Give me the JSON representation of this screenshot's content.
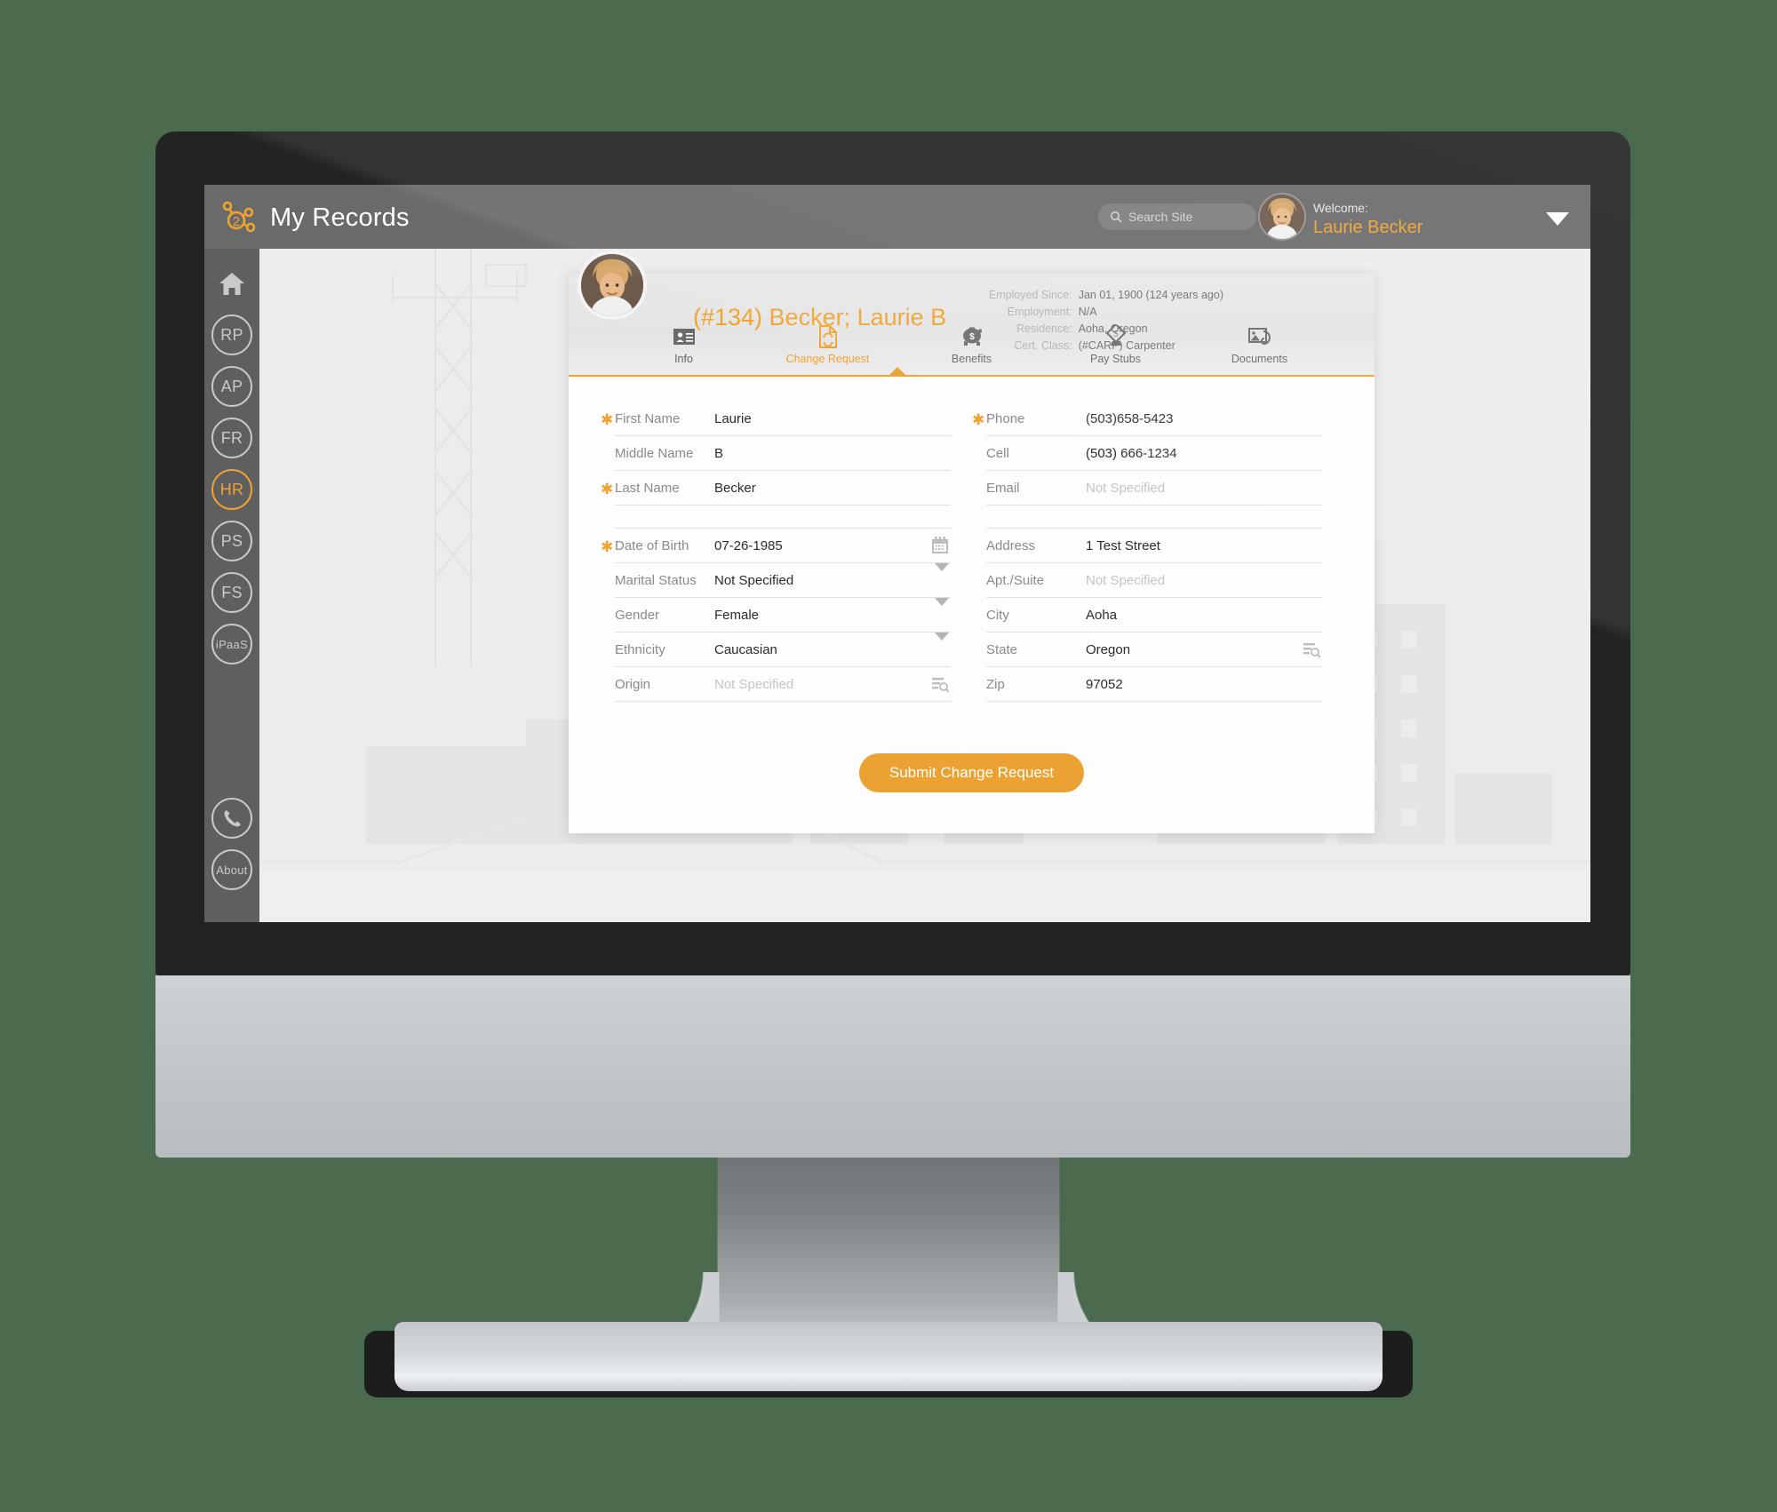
{
  "theme": {
    "accent": "#f0a32e",
    "topbar_bg": "#6a6a6a",
    "rail_bg": "#5f5f5f",
    "page_bg": "#4b6b4e",
    "card_bg": "#fdfdfd"
  },
  "topbar": {
    "app_title": "My Records",
    "logo_icon": "two-node-network-logo",
    "search": {
      "placeholder": "Search Site",
      "icon": "search-icon"
    },
    "welcome_label": "Welcome:",
    "welcome_name": "Laurie Becker",
    "caret_icon": "chevron-down-icon",
    "avatar_icon": "user-avatar"
  },
  "sidebar": {
    "items": [
      {
        "id": "home",
        "label": "",
        "icon": "home-icon",
        "style": "plain",
        "active": false
      },
      {
        "id": "rp",
        "label": "RP",
        "icon": "rp-icon",
        "style": "circle",
        "active": false
      },
      {
        "id": "ap",
        "label": "AP",
        "icon": "ap-icon",
        "style": "circle",
        "active": false
      },
      {
        "id": "fr",
        "label": "FR",
        "icon": "fr-icon",
        "style": "circle",
        "active": false
      },
      {
        "id": "hr",
        "label": "HR",
        "icon": "hr-icon",
        "style": "circle",
        "active": true
      },
      {
        "id": "ps",
        "label": "PS",
        "icon": "ps-icon",
        "style": "circle",
        "active": false
      },
      {
        "id": "fs",
        "label": "FS",
        "icon": "fs-icon",
        "style": "circle",
        "active": false
      },
      {
        "id": "ipaas",
        "label": "iPaaS",
        "icon": "ipaas-icon",
        "style": "circle-small",
        "active": false
      }
    ],
    "bottom_items": [
      {
        "id": "phone",
        "label": "",
        "icon": "phone-icon"
      },
      {
        "id": "about",
        "label": "About",
        "icon": "about-icon"
      }
    ]
  },
  "record": {
    "title": "(#134) Becker; Laurie B",
    "avatar_icon": "employee-avatar",
    "meta": [
      {
        "key": "Employed Since:",
        "value": "Jan 01, 1900 (124 years ago)"
      },
      {
        "key": "Employment:",
        "value": "N/A"
      },
      {
        "key": "Residence:",
        "value": "Aoha, Oregon"
      },
      {
        "key": "Cert. Class:",
        "value": "(#CARP) Carpenter"
      }
    ],
    "tabs": [
      {
        "id": "info",
        "label": "Info",
        "icon": "id-card-icon",
        "active": false
      },
      {
        "id": "change-request",
        "label": "Change Request",
        "icon": "document-sync-icon",
        "active": true
      },
      {
        "id": "benefits",
        "label": "Benefits",
        "icon": "piggy-bank-icon",
        "active": false
      },
      {
        "id": "pay-stubs",
        "label": "Pay Stubs",
        "icon": "money-stamp-icon",
        "active": false
      },
      {
        "id": "documents",
        "label": "Documents",
        "icon": "document-attach-icon",
        "active": false
      }
    ]
  },
  "form": {
    "left_fields": [
      {
        "id": "first-name",
        "label": "First Name",
        "value": "Laurie",
        "placeholder": "",
        "required": true,
        "adornment": "none"
      },
      {
        "id": "middle-name",
        "label": "Middle Name",
        "value": "B",
        "placeholder": "",
        "required": false,
        "adornment": "none"
      },
      {
        "id": "last-name",
        "label": "Last Name",
        "value": "Becker",
        "placeholder": "",
        "required": true,
        "adornment": "none"
      },
      {
        "id": "spacer-left",
        "label": "",
        "value": "",
        "placeholder": "",
        "required": false,
        "adornment": "spacer"
      },
      {
        "id": "date-of-birth",
        "label": "Date of Birth",
        "value": "07-26-1985",
        "placeholder": "",
        "required": true,
        "adornment": "calendar-icon"
      },
      {
        "id": "marital-status",
        "label": "Marital Status",
        "value": "Not Specified",
        "placeholder": "",
        "required": false,
        "adornment": "chevron-down-icon"
      },
      {
        "id": "gender",
        "label": "Gender",
        "value": "Female",
        "placeholder": "",
        "required": false,
        "adornment": "chevron-down-icon"
      },
      {
        "id": "ethnicity",
        "label": "Ethnicity",
        "value": "Caucasian",
        "placeholder": "",
        "required": false,
        "adornment": "chevron-down-icon"
      },
      {
        "id": "origin",
        "label": "Origin",
        "value": "",
        "placeholder": "Not Specified",
        "required": false,
        "adornment": "lookup-icon"
      }
    ],
    "right_fields": [
      {
        "id": "phone",
        "label": "Phone",
        "value": "(503)658-5423",
        "placeholder": "",
        "required": true,
        "adornment": "none"
      },
      {
        "id": "cell",
        "label": "Cell",
        "value": "(503) 666-1234",
        "placeholder": "",
        "required": false,
        "adornment": "none"
      },
      {
        "id": "email",
        "label": "Email",
        "value": "",
        "placeholder": "Not Specified",
        "required": false,
        "adornment": "none"
      },
      {
        "id": "spacer-right",
        "label": "",
        "value": "",
        "placeholder": "",
        "required": false,
        "adornment": "spacer"
      },
      {
        "id": "address",
        "label": "Address",
        "value": "1 Test Street",
        "placeholder": "",
        "required": false,
        "adornment": "none"
      },
      {
        "id": "apt-suite",
        "label": "Apt./Suite",
        "value": "",
        "placeholder": "Not Specified",
        "required": false,
        "adornment": "none"
      },
      {
        "id": "city",
        "label": "City",
        "value": "Aoha",
        "placeholder": "",
        "required": false,
        "adornment": "none"
      },
      {
        "id": "state",
        "label": "State",
        "value": "Oregon",
        "placeholder": "",
        "required": false,
        "adornment": "lookup-icon"
      },
      {
        "id": "zip",
        "label": "Zip",
        "value": "97052",
        "placeholder": "",
        "required": false,
        "adornment": "none"
      }
    ],
    "submit_label": "Submit Change Request"
  }
}
